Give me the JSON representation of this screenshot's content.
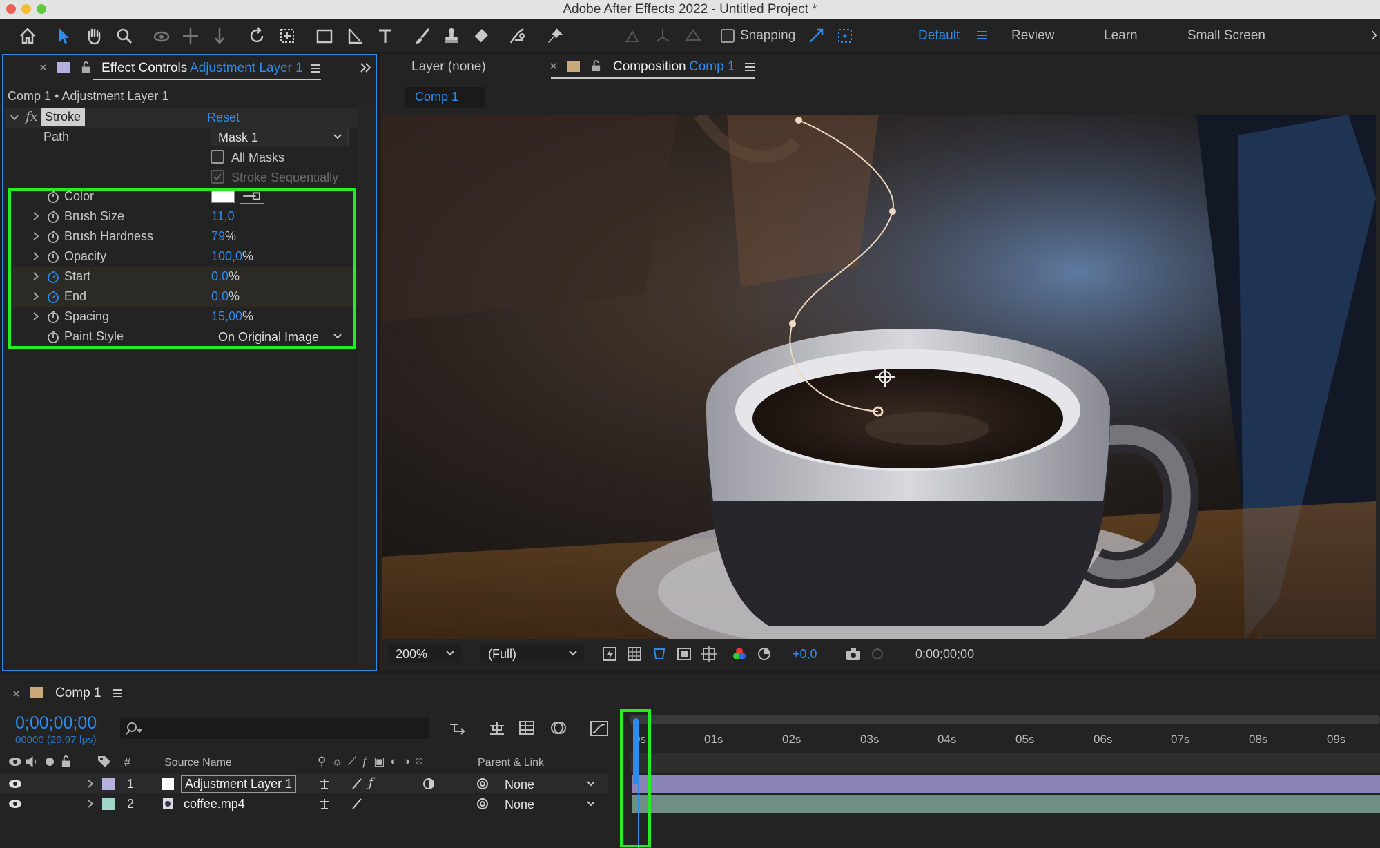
{
  "window": {
    "title": "Adobe After Effects 2022 - Untitled Project *"
  },
  "toolbar": {
    "tools": [
      "home-icon",
      "selection-tool-icon",
      "hand-tool-icon",
      "zoom-tool-icon",
      "orbit-camera-icon",
      "pan-camera-icon",
      "dolly-camera-icon",
      "rotation-tool-icon",
      "anchor-point-tool-icon",
      "rectangle-tool-icon",
      "pen-tool-icon",
      "type-tool-icon",
      "brush-tool-icon",
      "clone-stamp-icon",
      "eraser-tool-icon",
      "roto-brush-icon",
      "puppet-pin-icon"
    ],
    "snapping_label": "Snapping",
    "workspaces": [
      "Default",
      "Review",
      "Learn",
      "Small Screen"
    ],
    "active_workspace": "Default"
  },
  "effect_controls": {
    "tab_prefix": "Effect Controls",
    "tab_layer": "Adjustment Layer 1",
    "breadcrumb": "Comp 1 • Adjustment Layer 1",
    "effect_name": "Stroke",
    "fx_label": "fx",
    "reset_label": "Reset",
    "path_label": "Path",
    "path_value": "Mask 1",
    "all_masks_label": "All Masks",
    "stroke_seq_label": "Stroke Sequentially",
    "color_label": "Color",
    "color_value": "#ffffff",
    "properties": [
      {
        "label": "Brush Size",
        "value": "11,0",
        "unit": ""
      },
      {
        "label": "Brush Hardness",
        "value": "79",
        "unit": "%"
      },
      {
        "label": "Opacity",
        "value": "100,0",
        "unit": "%"
      },
      {
        "label": "Start",
        "value": "0,0",
        "unit": "%"
      },
      {
        "label": "End",
        "value": "0,0",
        "unit": "%"
      },
      {
        "label": "Spacing",
        "value": "15,00",
        "unit": "%"
      }
    ],
    "paint_style_label": "Paint Style",
    "paint_style_value": "On Original Image"
  },
  "viewer": {
    "layer_tab": "Layer (none)",
    "comp_tab_prefix": "Composition",
    "comp_tab_name": "Comp 1",
    "comp_button": "Comp 1",
    "zoom": "200%",
    "resolution": "(Full)",
    "exposure": "+0,0",
    "timecode": "0;00;00;00"
  },
  "timeline": {
    "tab": "Comp 1",
    "current_time": "0;00;00;00",
    "fps": "00000 (29.97 fps)",
    "columns": {
      "num": "#",
      "source": "Source Name",
      "parent": "Parent & Link"
    },
    "ticks": [
      "0s",
      "01s",
      "02s",
      "03s",
      "04s",
      "05s",
      "06s",
      "07s",
      "08s",
      "09s"
    ],
    "layers": [
      {
        "num": "1",
        "name": "Adjustment Layer 1",
        "parent": "None",
        "color": "#b4b0e0"
      },
      {
        "num": "2",
        "name": "coffee.mp4",
        "parent": "None",
        "color": "#9fd6c7"
      }
    ]
  },
  "colors": {
    "accent": "#2d8ceb",
    "highlight": "#22ee22",
    "adj_track": "#8a84b8",
    "video_track": "#6f8f86"
  }
}
